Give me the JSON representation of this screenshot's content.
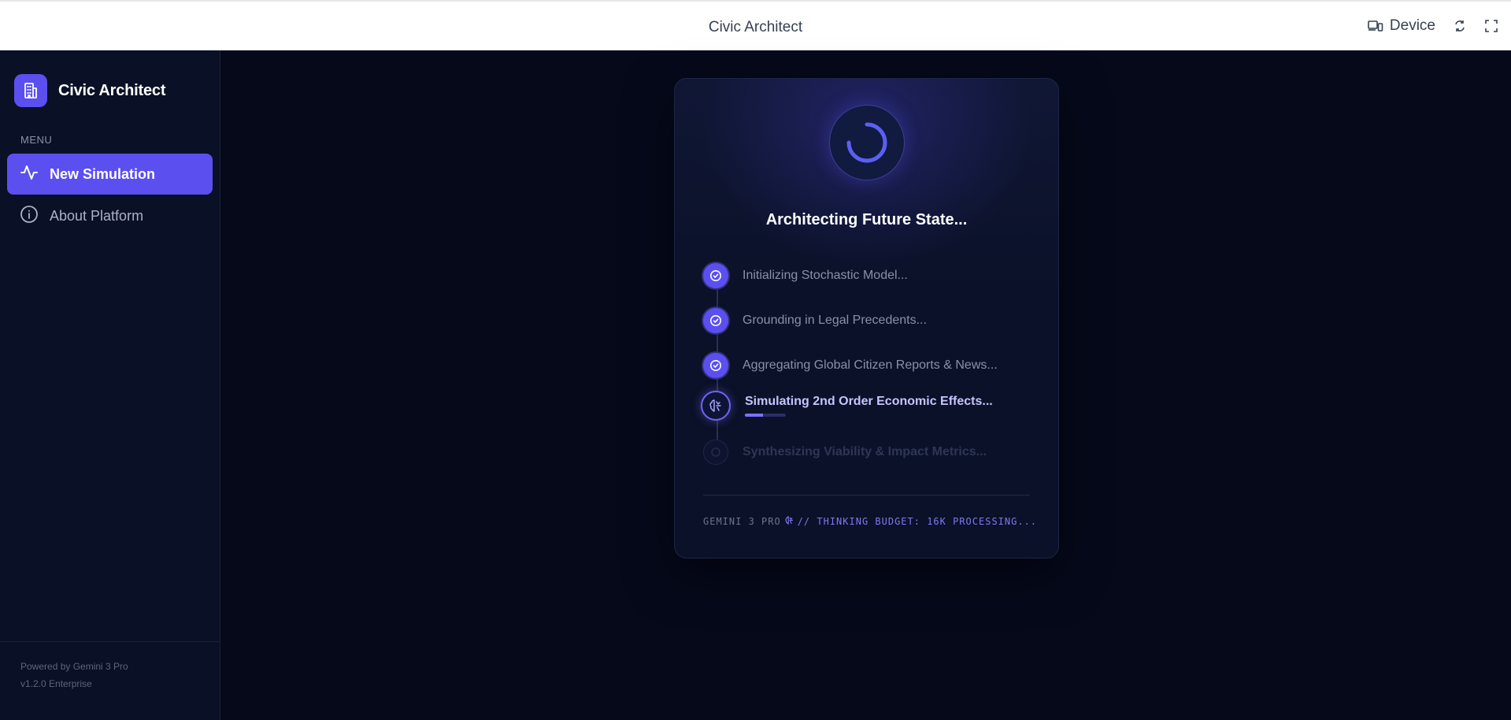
{
  "topbar": {
    "title": "Civic Architect",
    "device_label": "Device"
  },
  "sidebar": {
    "brand_name": "Civic Architect",
    "menu_label": "MENU",
    "items": [
      {
        "label": "New Simulation",
        "icon": "activity-icon",
        "active": true
      },
      {
        "label": "About Platform",
        "icon": "info-icon",
        "active": false
      }
    ],
    "footer": {
      "powered_by": "Powered by Gemini 3 Pro",
      "version": "v1.2.0 Enterprise"
    }
  },
  "loader": {
    "title": "Architecting Future State...",
    "steps": [
      {
        "label": "Initializing Stochastic Model...",
        "status": "done"
      },
      {
        "label": "Grounding in Legal Precedents...",
        "status": "done"
      },
      {
        "label": "Aggregating Global Citizen Reports & News...",
        "status": "done"
      },
      {
        "label": "Simulating 2nd Order Economic Effects...",
        "status": "active",
        "progress": 0.45
      },
      {
        "label": "Synthesizing Viability & Impact Metrics...",
        "status": "pending"
      }
    ],
    "footer_model": "GEMINI 3 PRO",
    "footer_status": "// THINKING BUDGET: 16K PROCESSING..."
  },
  "colors": {
    "accent": "#5b4ff0",
    "background": "#05091a",
    "sidebar": "#0a1025",
    "card": "#0b1128"
  }
}
